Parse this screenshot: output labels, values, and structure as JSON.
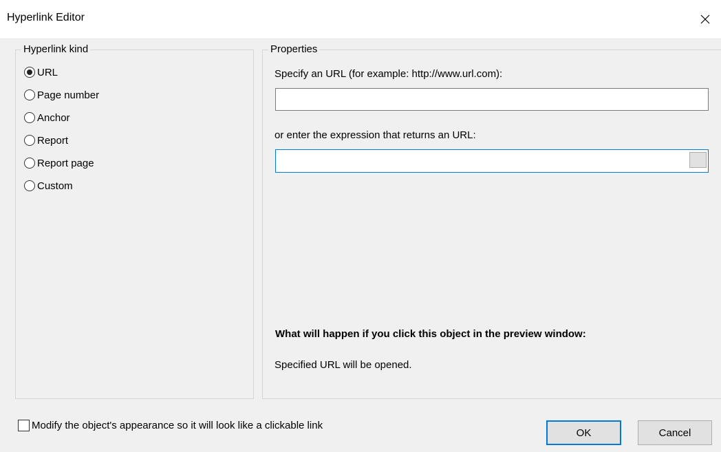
{
  "window": {
    "title": "Hyperlink Editor",
    "close_icon": "close-icon"
  },
  "kind_group": {
    "label": "Hyperlink kind",
    "options": [
      {
        "label": "URL",
        "selected": true
      },
      {
        "label": "Page number",
        "selected": false
      },
      {
        "label": "Anchor",
        "selected": false
      },
      {
        "label": "Report",
        "selected": false
      },
      {
        "label": "Report page",
        "selected": false
      },
      {
        "label": "Custom",
        "selected": false
      }
    ]
  },
  "properties": {
    "label": "Properties",
    "url_prompt": "Specify an URL (for example: http://www.url.com):",
    "url_value": "",
    "expr_prompt": "or enter the expression that returns an URL:",
    "expr_value": "",
    "preview_heading": "What will happen if you click this object in the preview window:",
    "preview_text": "Specified URL will be opened."
  },
  "footer": {
    "checkbox_label": "Modify the object's appearance so it will look like a clickable link",
    "checkbox_checked": false,
    "ok_label": "OK",
    "cancel_label": "Cancel"
  },
  "colors": {
    "focus_accent": "#0078d7",
    "background": "#f0f0f0"
  }
}
